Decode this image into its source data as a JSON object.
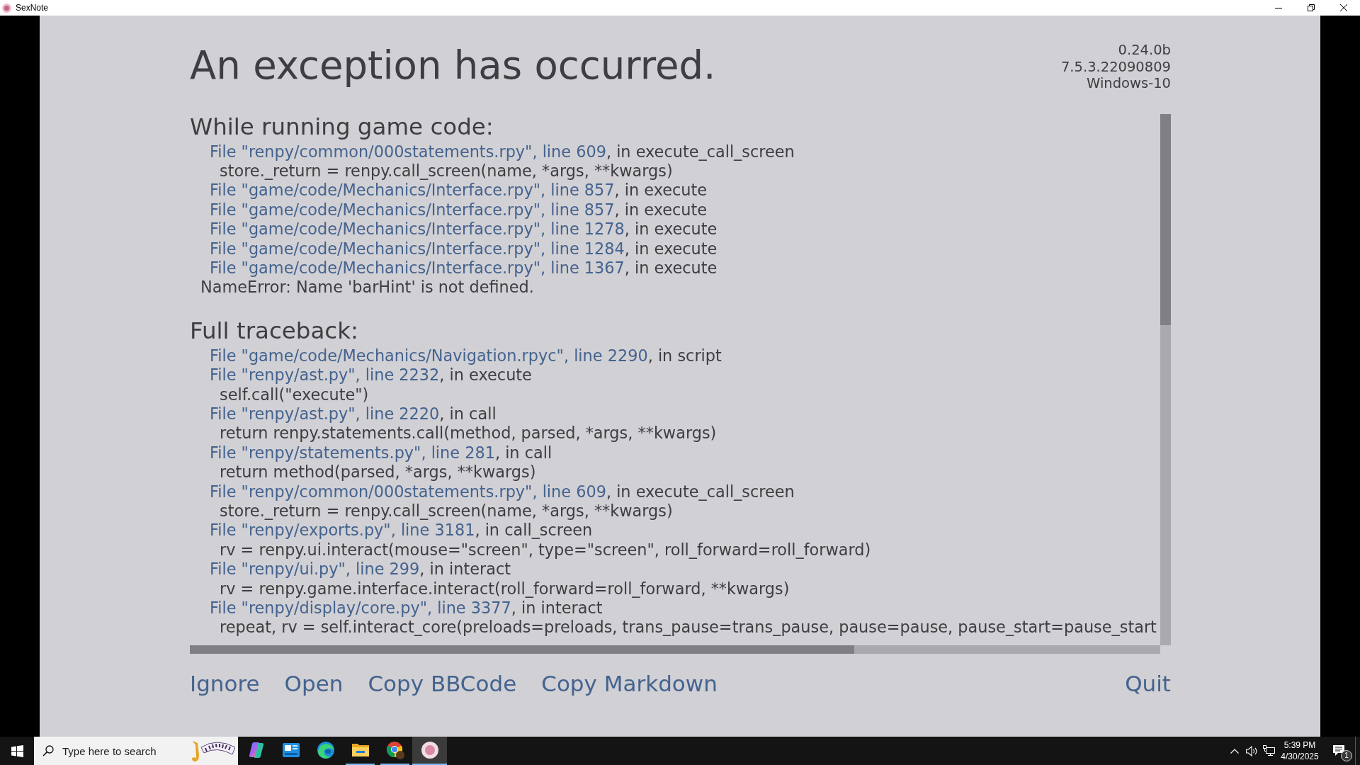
{
  "window": {
    "title": "SexNote"
  },
  "error_screen": {
    "title": "An exception has occurred.",
    "version_info": [
      "0.24.0b",
      "7.5.3.22090809",
      "Windows-10"
    ],
    "sections": [
      {
        "heading": "While running game code:",
        "lines": [
          {
            "kind": "frame",
            "link": "File \"renpy/common/000statements.rpy\", line 609",
            "text": ", in execute_call_screen"
          },
          {
            "kind": "code",
            "text": "store._return = renpy.call_screen(name, *args, **kwargs)"
          },
          {
            "kind": "frame",
            "link": "File \"game/code/Mechanics/Interface.rpy\", line 857",
            "text": ", in execute"
          },
          {
            "kind": "frame",
            "link": "File \"game/code/Mechanics/Interface.rpy\", line 857",
            "text": ", in execute"
          },
          {
            "kind": "frame",
            "link": "File \"game/code/Mechanics/Interface.rpy\", line 1278",
            "text": ", in execute"
          },
          {
            "kind": "frame",
            "link": "File \"game/code/Mechanics/Interface.rpy\", line 1284",
            "text": ", in execute"
          },
          {
            "kind": "frame",
            "link": "File \"game/code/Mechanics/Interface.rpy\", line 1367",
            "text": ", in execute"
          },
          {
            "kind": "error",
            "text": "NameError: Name 'barHint' is not defined."
          }
        ]
      },
      {
        "heading": "Full traceback:",
        "lines": [
          {
            "kind": "frame",
            "link": "File \"game/code/Mechanics/Navigation.rpyc\", line 2290",
            "text": ", in script"
          },
          {
            "kind": "frame",
            "link": "File \"renpy/ast.py\", line 2232",
            "text": ", in execute"
          },
          {
            "kind": "code",
            "text": "self.call(\"execute\")"
          },
          {
            "kind": "frame",
            "link": "File \"renpy/ast.py\", line 2220",
            "text": ", in call"
          },
          {
            "kind": "code",
            "text": "return renpy.statements.call(method, parsed, *args, **kwargs)"
          },
          {
            "kind": "frame",
            "link": "File \"renpy/statements.py\", line 281",
            "text": ", in call"
          },
          {
            "kind": "code",
            "text": "return method(parsed, *args, **kwargs)"
          },
          {
            "kind": "frame",
            "link": "File \"renpy/common/000statements.rpy\", line 609",
            "text": ", in execute_call_screen"
          },
          {
            "kind": "code",
            "text": "store._return = renpy.call_screen(name, *args, **kwargs)"
          },
          {
            "kind": "frame",
            "link": "File \"renpy/exports.py\", line 3181",
            "text": ", in call_screen"
          },
          {
            "kind": "code",
            "text": "rv = renpy.ui.interact(mouse=\"screen\", type=\"screen\", roll_forward=roll_forward)"
          },
          {
            "kind": "frame",
            "link": "File \"renpy/ui.py\", line 299",
            "text": ", in interact"
          },
          {
            "kind": "code",
            "text": "rv = renpy.game.interface.interact(roll_forward=roll_forward, **kwargs)"
          },
          {
            "kind": "frame",
            "link": "File \"renpy/display/core.py\", line 3377",
            "text": ", in interact"
          },
          {
            "kind": "code",
            "text": "repeat, rv = self.interact_core(preloads=preloads, trans_pause=trans_pause, pause=pause, pause_start=pause_start"
          }
        ]
      }
    ],
    "buttons": [
      "Ignore",
      "Open",
      "Copy BBCode",
      "Copy Markdown"
    ],
    "quit_button": "Quit"
  },
  "taskbar": {
    "search": {
      "placeholder": "Type here to search"
    },
    "apps": [
      {
        "kind": "ribbon",
        "running": false,
        "selected": false
      },
      {
        "kind": "card",
        "running": false,
        "selected": false
      },
      {
        "kind": "swirl",
        "running": false,
        "selected": false
      },
      {
        "kind": "folder",
        "running": true,
        "selected": false
      },
      {
        "kind": "segmented",
        "running": true,
        "selected": false
      },
      {
        "kind": "avatar",
        "running": true,
        "selected": true
      }
    ],
    "clock": {
      "time": "5:39 PM",
      "date": "4/30/2025"
    },
    "notification_count": "1"
  }
}
